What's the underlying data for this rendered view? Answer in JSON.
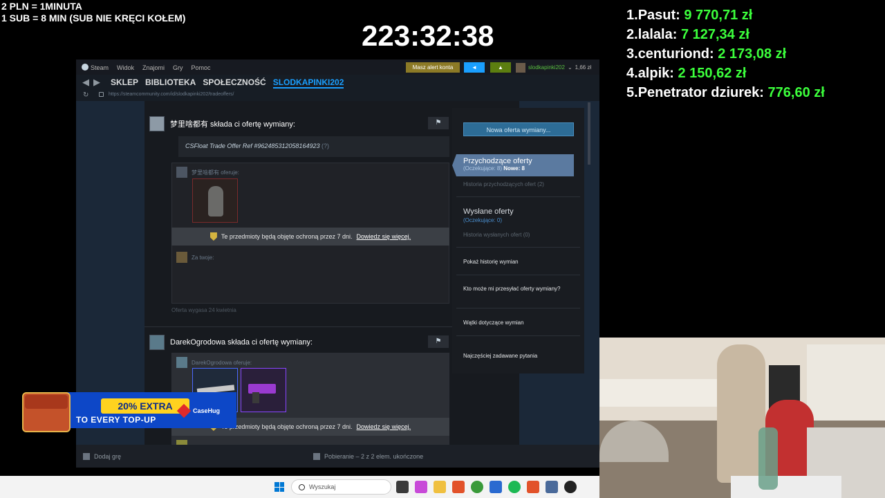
{
  "overlay": {
    "rate_line1": "2 PLN =  1MINUTA",
    "rate_line2": "1 SUB = 8 MIN (SUB NIE KRĘCI KOŁEM)",
    "timer": "223:32:38",
    "leaderboard": [
      {
        "rank": "1.",
        "name": "Pasut:",
        "amount": "9 770,71 zł"
      },
      {
        "rank": "2.",
        "name": "lalala:",
        "amount": "7 127,34 zł"
      },
      {
        "rank": "3.",
        "name": "centuriond:",
        "amount": "2 173,08 zł"
      },
      {
        "rank": "4.",
        "name": "alpik:",
        "amount": "2 150,62 zł"
      },
      {
        "rank": "5.",
        "name": "Penetrator dziurek:",
        "amount": "776,60 zł"
      }
    ]
  },
  "steam": {
    "menu": [
      "Steam",
      "Widok",
      "Znajomi",
      "Gry",
      "Pomoc"
    ],
    "alert_button": "Masz alert konta",
    "account_name": "slodkapinki202",
    "wallet": "1,66 zł",
    "nav": [
      "SKLEP",
      "BIBLIOTEKA",
      "SPOŁECZNOŚĆ",
      "SLODKAPINKI202"
    ],
    "url": "https://steamcommunity.com/id/slodkapinki202/tradeoffers/",
    "offers": [
      {
        "header": "梦里啥都有 składa ci ofertę wymiany:",
        "note": "CSFloat Trade Offer Ref #962485312058164923",
        "note_q": "(?)",
        "offers_label": "梦里啥都有 oferuje:",
        "protect_text": "Te przedmioty będą objęte ochroną przez 7 dni.",
        "protect_link": "Dowiedz się więcej.",
        "for_you": "Za twoje:",
        "expired": "Oferta wygasa 24 kwietnia"
      },
      {
        "header": "DarekOgrodowa składa ci ofertę wymiany:",
        "offers_label": "DarekOgrodowa oferuje:",
        "protect_text": "Te przedmioty będą objęte ochroną przez 7 dni.",
        "protect_link": "Dowiedz się więcej."
      }
    ],
    "sidebar": {
      "new_offer": "Nowa oferta wymiany...",
      "incoming_title": "Przychodzące oferty",
      "incoming_pending": "(Oczekujące: 8)",
      "incoming_new": "Nowe: 8",
      "incoming_history": "Historia przychodzących ofert (2)",
      "sent_title": "Wysłane oferty",
      "sent_pending": "(Oczekujące: 0)",
      "sent_history": "Historia wysłanych ofert (0)",
      "link1": "Pokaż historię wymian",
      "link2": "Kto może mi przesyłać oferty wymiany?",
      "link3": "Wątki dotyczące wymian",
      "link4": "Najczęściej zadawane pytania"
    },
    "bottom": {
      "add_game": "Dodaj grę",
      "downloads": "Pobieranie – 2 z 2 elem. ukończone"
    }
  },
  "promo": {
    "extra": "20% EXTRA",
    "every": "TO EVERY TOP-UP",
    "brand": "CaseHug"
  },
  "taskbar": {
    "search_placeholder": "Wyszukaj"
  },
  "colors": {
    "leader_amount": "#3cff3c",
    "steam_accent": "#1a9fff",
    "alert": "#8c7a26"
  }
}
